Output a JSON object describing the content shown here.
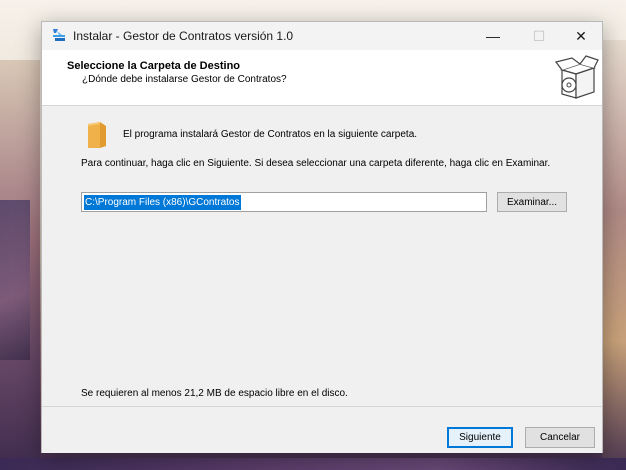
{
  "window": {
    "title": "Instalar - Gestor de Contratos versión 1.0",
    "controls": {
      "minimize": "—",
      "maximize": "☐",
      "close": "✕"
    }
  },
  "header": {
    "title": "Seleccione la Carpeta de Destino",
    "subtitle": "¿Dónde debe instalarse Gestor de Contratos?"
  },
  "body": {
    "install_message": "El programa instalará Gestor de Contratos en la siguiente carpeta.",
    "continue_message": "Para continuar, haga clic en Siguiente. Si desea seleccionar una carpeta diferente, haga clic en Examinar.",
    "path_value": "C:\\Program Files (x86)\\GContratos",
    "browse_label": "Examinar...",
    "space_message": "Se requieren al menos 21,2 MB de espacio libre en el disco."
  },
  "footer": {
    "next_label": "Siguiente",
    "cancel_label": "Cancelar"
  },
  "icons": {
    "app": "installer-icon",
    "setup": "setup-box-icon",
    "folder": "folder-icon"
  },
  "colors": {
    "accent": "#0078d7",
    "folder": "#f0b04a"
  }
}
